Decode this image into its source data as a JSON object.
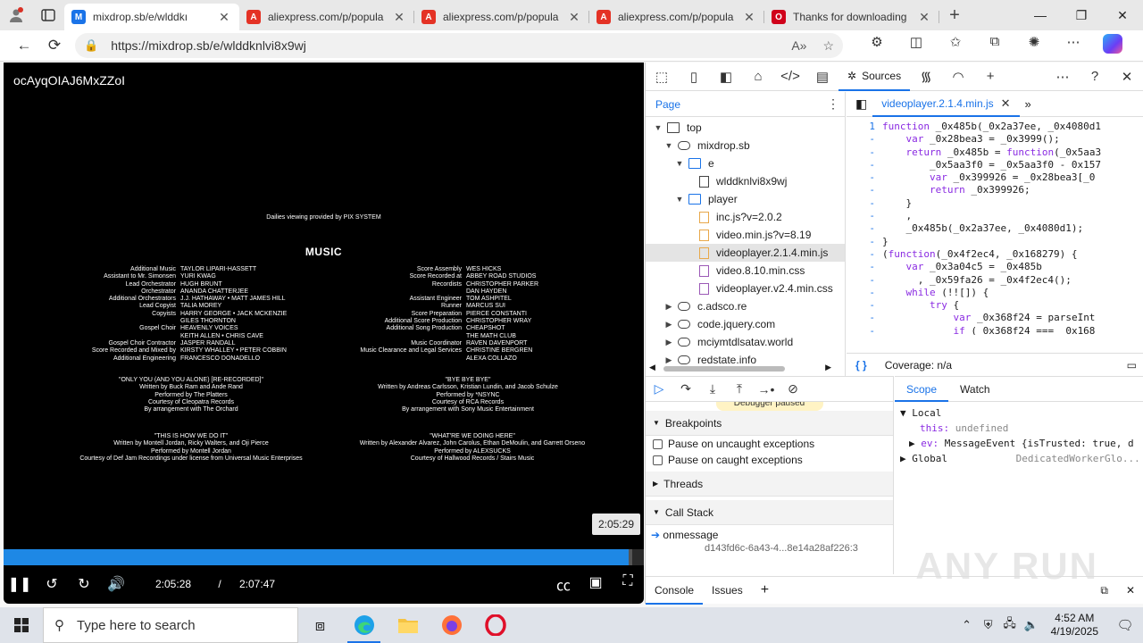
{
  "browser": {
    "tabs": [
      {
        "title": "mixdrop.sb/e/wlddkı",
        "fav_color": "#1a73e8",
        "fav_char": "M",
        "active": true
      },
      {
        "title": "aliexpress.com/p/popula",
        "fav_color": "#e43225",
        "fav_char": "A",
        "active": false
      },
      {
        "title": "aliexpress.com/p/popula",
        "fav_color": "#e43225",
        "fav_char": "A",
        "active": false
      },
      {
        "title": "aliexpress.com/p/popula",
        "fav_color": "#e43225",
        "fav_char": "A",
        "active": false
      },
      {
        "title": "Thanks for downloading",
        "fav_color": "#d0021b",
        "fav_char": "O",
        "active": false
      }
    ],
    "url": "https://mixdrop.sb/e/wlddknlvi8x9wj"
  },
  "player": {
    "title": "ocAyqOIAJ6MxZZoI",
    "credits_top": "Dailies viewing provided by PIX SYSTEM",
    "credits_heading": "MUSIC",
    "credits_left": [
      [
        "Additional Music",
        "TAYLOR LIPARI-HASSETT"
      ],
      [
        "Assistant to Mr. Simonsen",
        "YURI KWAG"
      ],
      [
        "Lead Orchestrator",
        "HUGH BRUNT"
      ],
      [
        "Orchestrator",
        "ANANDA CHATTERJEE"
      ],
      [
        "Additional Orchestrators",
        "J.J. HATHAWAY • MATT JAMES HILL"
      ],
      [
        "Lead Copyist",
        "TALIA MOREY"
      ],
      [
        "Copyists",
        "HARRY GEORGE • JACK MCKENZIE"
      ],
      [
        "",
        "GILES THORNTON"
      ],
      [
        "Gospel Choir",
        "HEAVENLY VOICES"
      ],
      [
        "",
        "KEITH ALLEN • CHRIS CAVE"
      ],
      [
        "Gospel Choir Contractor",
        "JASPER RANDALL"
      ],
      [
        "Score Recorded and Mixed by",
        "KIRSTY WHALLEY • PETER COBBIN"
      ],
      [
        "Additional Engineering",
        "FRANCESCO DONADELLO"
      ]
    ],
    "credits_right": [
      [
        "Score Assembly",
        "WES HICKS"
      ],
      [
        "Score Recorded at",
        "ABBEY ROAD STUDIOS"
      ],
      [
        "Recordists",
        "CHRISTOPHER PARKER"
      ],
      [
        "",
        "DAN HAYDEN"
      ],
      [
        "Assistant Engineer",
        "TOM ASHPITEL"
      ],
      [
        "Runner",
        "MARCUS SUI"
      ],
      [
        "Score Preparation",
        "PIERCE CONSTANTI"
      ],
      [
        "Additional Score Production",
        "CHRISTOPHER WRAY"
      ],
      [
        "Additional Song Production",
        "CHEAPSHOT"
      ],
      [
        "",
        "THE MATH CLUB"
      ],
      [
        "Music Coordinator",
        "RAVEN DAVENPORT"
      ],
      [
        "Music Clearance and Legal Services",
        "CHRISTINE BERGREN"
      ],
      [
        "",
        "ALEXA COLLAZO"
      ]
    ],
    "songs": [
      [
        "\"ONLY YOU (AND YOU ALONE) [RE-RECORDED]\"",
        "Written by Buck Ram and Ande Rand",
        "Performed by The Platters",
        "Courtesy of Cleopatra Records",
        "By arrangement with The Orchard"
      ],
      [
        "\"BYE BYE BYE\"",
        "Written by Andreas Carlsson, Kristian Lundin, and Jacob Schulze",
        "Performed by *NSYNC",
        "Courtesy of RCA Records",
        "By arrangement with Sony Music Entertainment"
      ],
      [
        "\"THIS IS HOW WE DO IT\"",
        "Written by Montell Jordan, Ricky Walters, and Oji Pierce",
        "Performed by Montell Jordan",
        "Courtesy of Def Jam Recordings under license from Universal Music Enterprises"
      ],
      [
        "\"WHAT'RE WE DOING HERE\"",
        "Written by Alexander Alvarez, John Carolus, Ethan DeMoulin, and Garrett Orseno",
        "Performed by ALEXSUCKS",
        "Courtesy of Hallwood Records / Stairs Music"
      ]
    ],
    "tooltip_time": "2:05:29",
    "current_time": "2:05:28",
    "slash": "/",
    "duration": "2:07:47",
    "progress_fraction": 0.979
  },
  "devtools": {
    "sources_tab": "Sources",
    "page_tab": "Page",
    "tree": [
      {
        "label": "top",
        "indent": 0,
        "tw": "▼",
        "icon": "frame"
      },
      {
        "label": "mixdrop.sb",
        "indent": 1,
        "tw": "▼",
        "icon": "cloud"
      },
      {
        "label": "e",
        "indent": 2,
        "tw": "▼",
        "icon": "folder"
      },
      {
        "label": "wlddknlvi8x9wj",
        "indent": 3,
        "tw": "",
        "icon": "file"
      },
      {
        "label": "player",
        "indent": 2,
        "tw": "▼",
        "icon": "folder"
      },
      {
        "label": "inc.js?v=2.0.2",
        "indent": 3,
        "tw": "",
        "icon": "jsfile"
      },
      {
        "label": "video.min.js?v=8.19",
        "indent": 3,
        "tw": "",
        "icon": "jsfile"
      },
      {
        "label": "videoplayer.2.1.4.min.js",
        "indent": 3,
        "tw": "",
        "icon": "jsfile",
        "selected": true
      },
      {
        "label": "video.8.10.min.css",
        "indent": 3,
        "tw": "",
        "icon": "cssfile"
      },
      {
        "label": "videoplayer.v2.4.min.css",
        "indent": 3,
        "tw": "",
        "icon": "cssfile"
      },
      {
        "label": "c.adsco.re",
        "indent": 1,
        "tw": "▶",
        "icon": "cloud"
      },
      {
        "label": "code.jquery.com",
        "indent": 1,
        "tw": "▶",
        "icon": "cloud"
      },
      {
        "label": "mciymtdlsatav.world",
        "indent": 1,
        "tw": "▶",
        "icon": "cloud"
      },
      {
        "label": "redstate.info",
        "indent": 1,
        "tw": "▶",
        "icon": "cloud"
      }
    ],
    "open_file": "videoplayer.2.1.4.min.js",
    "code_lines": [
      {
        "g": "1",
        "t": "function _0x485b(_0x2a37ee, _0x4080d1"
      },
      {
        "g": "-",
        "t": "    var _0x28bea3 = _0x3999();"
      },
      {
        "g": "-",
        "t": "    return _0x485b = function(_0x5aa3"
      },
      {
        "g": "-",
        "t": "        _0x5aa3f0 = _0x5aa3f0 - 0x157"
      },
      {
        "g": "-",
        "t": "        var _0x399926 = _0x28bea3[_0"
      },
      {
        "g": "-",
        "t": "        return _0x399926;"
      },
      {
        "g": "-",
        "t": "    }"
      },
      {
        "g": "-",
        "t": "    ,"
      },
      {
        "g": "-",
        "t": "    _0x485b(_0x2a37ee, _0x4080d1);"
      },
      {
        "g": "-",
        "t": "}"
      },
      {
        "g": "-",
        "t": "(function(_0x4f2ec4, _0x168279) {"
      },
      {
        "g": "-",
        "t": "    var _0x3a04c5 = _0x485b"
      },
      {
        "g": "-",
        "t": "      , _0x59fa26 = _0x4f2ec4();"
      },
      {
        "g": "-",
        "t": "    while (!![]) {"
      },
      {
        "g": "-",
        "t": "        try {"
      },
      {
        "g": "-",
        "t": "            var _0x368f24 = parseInt"
      },
      {
        "g": "-",
        "t": "            if (_0x368f24 === _0x168"
      }
    ],
    "coverage": "Coverage: n/a",
    "paused_text": "Debugger paused",
    "breakpoints_label": "Breakpoints",
    "pause_uncaught": "Pause on uncaught exceptions",
    "pause_caught": "Pause on caught exceptions",
    "threads_label": "Threads",
    "callstack_label": "Call Stack",
    "call_frame": "onmessage",
    "call_frame_loc": "d143fd6c-6a43-4...8e14a28af226:3",
    "scope_tab": "Scope",
    "watch_tab": "Watch",
    "scope_local": "Local",
    "scope_this": "this:",
    "scope_this_val": "undefined",
    "scope_ev": "ev:",
    "scope_ev_val": "MessageEvent {isTrusted: true, d",
    "scope_global": "Global",
    "scope_global_val": "DedicatedWorkerGlo...",
    "console_tab": "Console",
    "issues_tab": "Issues"
  },
  "watermark": "ANY RUN",
  "taskbar": {
    "search_placeholder": "Type here to search",
    "time": "4:52 AM",
    "date": "4/19/2025"
  }
}
